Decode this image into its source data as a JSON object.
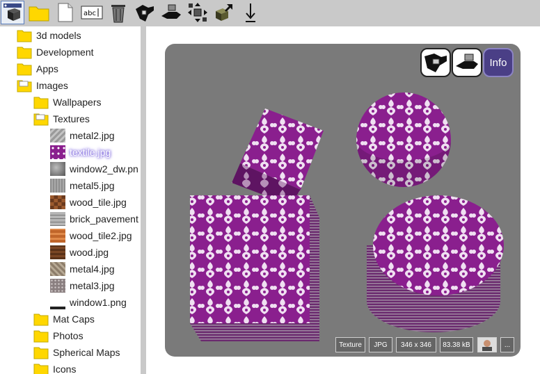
{
  "toolbar": {
    "buttons": [
      "view-3d-icon",
      "folder-icon",
      "file-icon",
      "rename-icon",
      "trash-icon",
      "grab-hand-icon",
      "drop-hand-icon",
      "move-icon",
      "import-export-icon",
      "download-icon"
    ]
  },
  "tree": {
    "folders": [
      {
        "label": "3d models"
      },
      {
        "label": "Development"
      },
      {
        "label": "Apps"
      },
      {
        "label": "Images"
      }
    ],
    "images_children": [
      {
        "label": "Wallpapers"
      },
      {
        "label": "Textures"
      }
    ],
    "textures": [
      {
        "label": "metal2.jpg"
      },
      {
        "label": "textile.jpg"
      },
      {
        "label": "window2_dw.pn"
      },
      {
        "label": "metal5.jpg"
      },
      {
        "label": "wood_tile.jpg"
      },
      {
        "label": "brick_pavement"
      },
      {
        "label": "wood_tile2.jpg"
      },
      {
        "label": "wood.jpg"
      },
      {
        "label": "metal4.jpg"
      },
      {
        "label": "metal3.jpg"
      },
      {
        "label": "window1.png"
      }
    ],
    "after": [
      {
        "label": "Mat Caps"
      },
      {
        "label": "Photos"
      },
      {
        "label": "Spherical Maps"
      },
      {
        "label": "Icons"
      }
    ]
  },
  "viewer": {
    "info_label": "Info",
    "meta": {
      "type": "Texture",
      "format": "JPG",
      "dims": "346 x 346",
      "size": "83.38 kB",
      "more": "..."
    }
  },
  "colors": {
    "purple": "#8a1f8e",
    "bg_gray": "#7a7a7a",
    "toolbar": "#c9c9c9"
  }
}
